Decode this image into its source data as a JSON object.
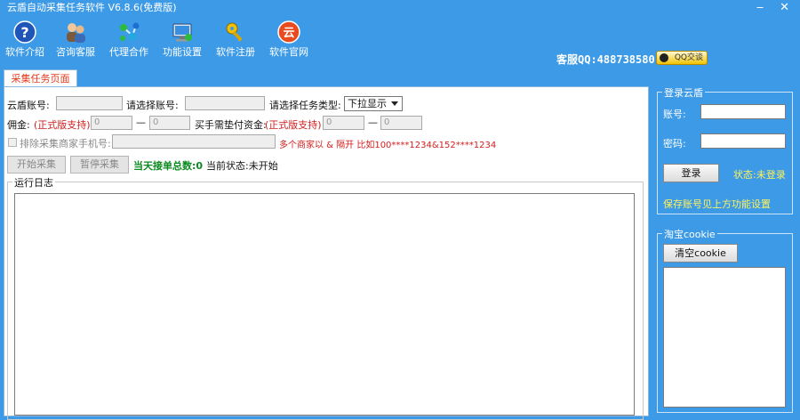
{
  "window": {
    "title": "云盾自动采集任务软件 V6.8.6(免费版)",
    "minimize": "‒",
    "close": "✕"
  },
  "toolbar": {
    "items": [
      {
        "label": "软件介绍",
        "icon": "help-icon"
      },
      {
        "label": "咨询客服",
        "icon": "users-icon"
      },
      {
        "label": "代理合作",
        "icon": "network-icon"
      },
      {
        "label": "功能设置",
        "icon": "computer-settings-icon"
      },
      {
        "label": "软件注册",
        "icon": "key-icon"
      },
      {
        "label": "软件官网",
        "icon": "cloud-logo-icon"
      }
    ],
    "logo_char": "云",
    "service_text": "客服QQ:488738580",
    "qq_button": "QQ交谈"
  },
  "tab": {
    "label": "采集任务页面"
  },
  "form": {
    "yundun_account_label": "云盾账号:",
    "select_account_label": "请选择账号:",
    "task_type_label": "请选择任务类型:",
    "task_type_value": "下拉显示",
    "commission_label": "佣金:",
    "pro_support": "(正式版支持)",
    "commission_min": "0",
    "commission_max": "0",
    "dash": "—",
    "advance_label": "买手需垫付资金:",
    "advance_min": "0",
    "advance_max": "0",
    "exclude_phone_label": "排除采集商家手机号:",
    "exclude_hint": "多个商家以 & 隔开 比如100****1234&152****1234",
    "start_button": "开始采集",
    "pause_button": "暂停采集",
    "today_total_label": "当天接单总数:0",
    "status_label": "当前状态:未开始"
  },
  "log": {
    "title": "运行日志"
  },
  "login": {
    "group_title": "登录云盾",
    "account_label": "账号:",
    "password_label": "密码:",
    "login_button": "登录",
    "status_text": "状态:未登录",
    "save_hint": "保存账号见上方功能设置"
  },
  "cookie": {
    "group_title": "淘宝cookie",
    "clear_button": "清空cookie"
  },
  "colors": {
    "background": "#3d9ae6",
    "warning_red": "#d11d1d",
    "count_green": "#0a8a1f",
    "hint_yellow": "#fff35a"
  }
}
